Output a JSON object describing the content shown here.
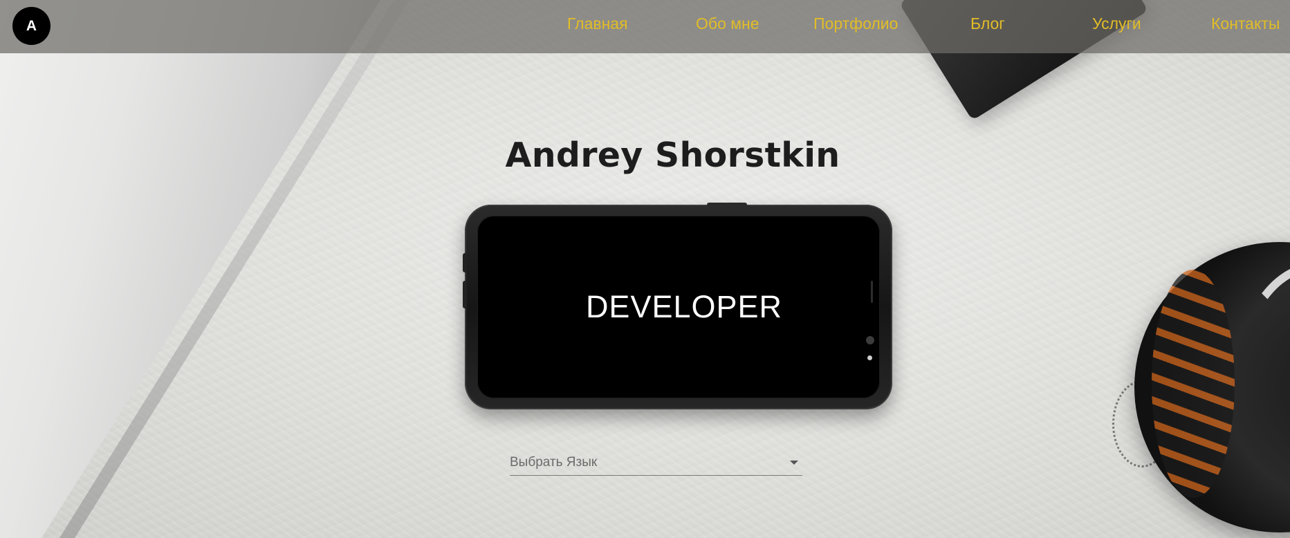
{
  "header": {
    "logo_letter": "A",
    "nav": [
      {
        "label": "Главная"
      },
      {
        "label": "Обо мне"
      },
      {
        "label": "Портфолио"
      },
      {
        "label": "Блог"
      },
      {
        "label": "Услуги"
      },
      {
        "label": "Контакты"
      }
    ],
    "nav_color": "#e2bd27",
    "bar_color": "#6e6c68"
  },
  "hero": {
    "name": "Andrey Shorstkin",
    "phone_text": "DEVELOPER"
  },
  "language_select": {
    "selected_label": "Выбрать Язык",
    "icon": "chevron-down-icon"
  }
}
